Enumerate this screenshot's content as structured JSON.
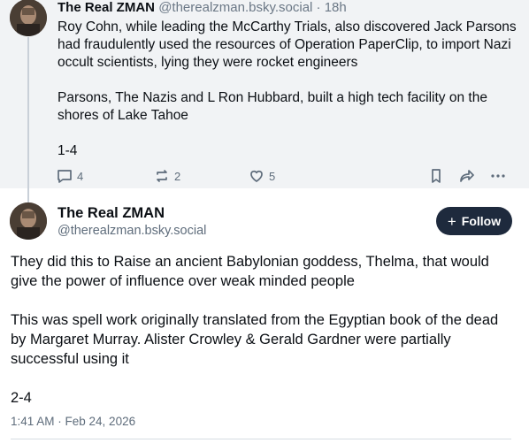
{
  "parent_post": {
    "author_name": "The Real ZMAN",
    "author_handle": "@therealzman.bsky.social",
    "separator": "·",
    "time_ago": "18h",
    "paragraphs": [
      "Roy Cohn, while leading the McCarthy Trials, also discovered Jack Parsons had fraudulently used the resources of Operation PaperClip, to import Nazi occult scientists, lying they were rocket engineers",
      "Parsons, The Nazis and L Ron Hubbard, built a high tech facility on the shores of Lake Tahoe",
      "1-4"
    ],
    "reply_count": "4",
    "repost_count": "2",
    "like_count": "5",
    "icons": [
      "reply-icon",
      "repost-icon",
      "like-icon",
      "bookmark-icon",
      "share-icon",
      "more-icon"
    ]
  },
  "main_post": {
    "author_name": "The Real ZMAN",
    "author_handle": "@therealzman.bsky.social",
    "follow_label": "Follow",
    "paragraphs": [
      "They did this to Raise an ancient Babylonian goddess, Thelma, that would give the  power of influence over weak minded people",
      "This was spell work originally translated from the Egyptian book of the dead by Margaret Murray.  Alister Crowley & Gerald Gardner were partially successful using it",
      "2-4"
    ],
    "timestamp": "1:41 AM · Feb 24, 2026"
  },
  "colors": {
    "parent_background": "#f1f3f5",
    "follow_button": "#1e2a3d",
    "muted_text": "#5e6c7b",
    "thread_line": "#c9d0d8"
  }
}
